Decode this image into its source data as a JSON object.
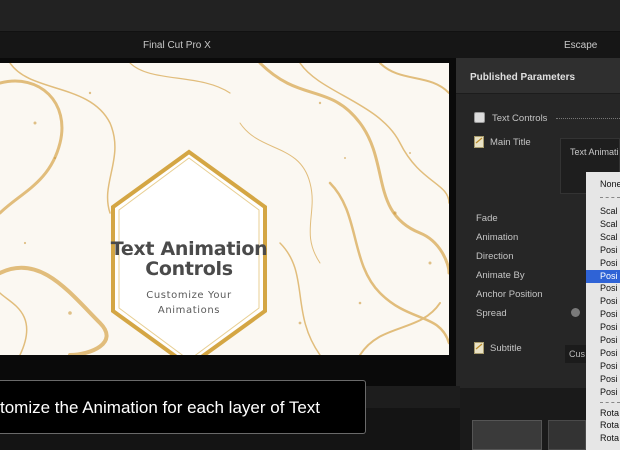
{
  "app": {
    "title": "Final Cut Pro X",
    "escape_label": "Escape"
  },
  "viewer": {
    "title": "Text Animation Controls",
    "title_line1": "Text Animation",
    "title_line2": "Controls",
    "subtitle_line1": "Customize Your",
    "subtitle_line2": "Animations",
    "accent_color": "#d4a644"
  },
  "inspector": {
    "header": "Published Parameters",
    "text_controls": "Text Controls",
    "main_title": "Main Title",
    "params": [
      "Fade",
      "Animation",
      "Direction",
      "Animate By",
      "Anchor Position",
      "Spread"
    ],
    "subtitle": "Subtitle"
  },
  "popup": {
    "header_text": "Text Animati",
    "none_label": "None",
    "items": [
      "Scal",
      "Scal",
      "Scal",
      "Posi",
      "Posi",
      "Posi",
      "Posi",
      "Posi",
      "Posi",
      "Posi",
      "Posi",
      "Posi",
      "Posi",
      "Posi",
      "Posi"
    ],
    "selected_index": 5,
    "rotate_items": [
      "Rota",
      "Rota",
      "Rota"
    ],
    "selection_color": "#2f63d6"
  },
  "cus_label": "Cus",
  "caption": {
    "text": "tomize the Animation for each layer of Text"
  }
}
